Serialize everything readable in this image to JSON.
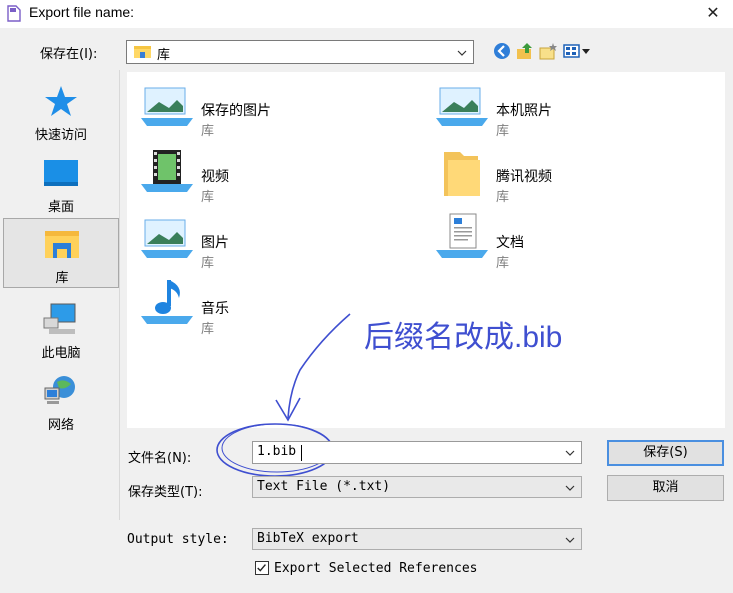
{
  "window": {
    "title": "Export file name:",
    "close_glyph": "✕"
  },
  "save_in": {
    "label": "保存在(I):",
    "value": "库"
  },
  "places": [
    {
      "label": "快速访问",
      "icon": "star-icon"
    },
    {
      "label": "桌面",
      "icon": "desktop-icon"
    },
    {
      "label": "库",
      "icon": "library-icon",
      "selected": true
    },
    {
      "label": "此电脑",
      "icon": "computer-icon"
    },
    {
      "label": "网络",
      "icon": "network-icon"
    }
  ],
  "files": [
    {
      "name": "保存的图片",
      "type": "库",
      "icon": "pictures-library-icon"
    },
    {
      "name": "本机照片",
      "type": "库",
      "icon": "pictures-library-icon"
    },
    {
      "name": "视频",
      "type": "库",
      "icon": "videos-library-icon"
    },
    {
      "name": "腾讯视频",
      "type": "库",
      "icon": "folder-icon"
    },
    {
      "name": "图片",
      "type": "库",
      "icon": "pictures-library-icon"
    },
    {
      "name": "文档",
      "type": "库",
      "icon": "documents-library-icon"
    },
    {
      "name": "音乐",
      "type": "库",
      "icon": "music-library-icon"
    }
  ],
  "annotation": {
    "text": "后缀名改成.bib"
  },
  "form": {
    "filename_label": "文件名(N):",
    "filename_value": "1.bib",
    "filetype_label": "保存类型(T):",
    "filetype_value": "Text File (*.txt)",
    "save_button": "保存(S)",
    "cancel_button": "取消",
    "output_style_label": "Output style:",
    "output_style_value": "BibTeX export",
    "export_selected_label": "Export Selected References",
    "export_selected_checked": true
  },
  "colors": {
    "annotation": "#3f4fd0",
    "default_button_border": "#4a8fe0"
  }
}
